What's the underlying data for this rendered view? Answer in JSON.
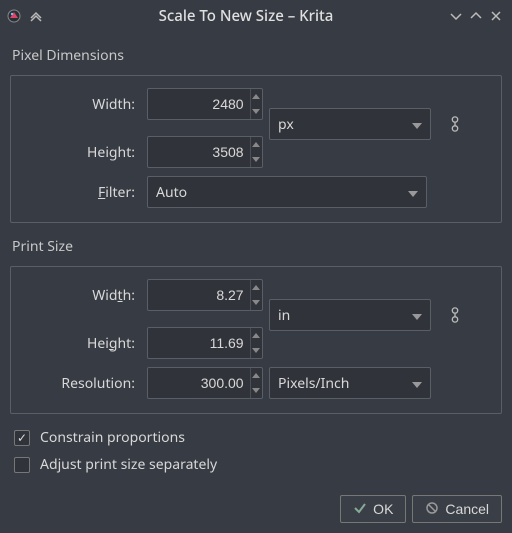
{
  "window": {
    "title": "Scale To New Size – Krita"
  },
  "pixel_dimensions": {
    "title": "Pixel Dimensions",
    "width_label_pre": "",
    "width_label": "Width:",
    "height_label": "Height:",
    "filter_label_pre": "F",
    "filter_label_post": "ilter:",
    "width_value": "2480",
    "height_value": "3508",
    "unit": "px",
    "filter_value": "Auto"
  },
  "print_size": {
    "title": "Print Size",
    "width_label_pre": "Wid",
    "width_label_ul": "t",
    "width_label_post": "h:",
    "height_label_pre": "Hei",
    "height_label_ul": "g",
    "height_label_post": "ht:",
    "resolution_label": "Resolution:",
    "width_value": "8.27",
    "height_value": "11.69",
    "resolution_value": "300.00",
    "unit": "in",
    "res_unit": "Pixels/Inch"
  },
  "options": {
    "constrain_pre": "Constrain ",
    "constrain_ul": "p",
    "constrain_post": "roportions",
    "constrain_checked": true,
    "adjust_ul": "A",
    "adjust_post": "djust print size separately",
    "adjust_checked": false
  },
  "buttons": {
    "ok_ul": "O",
    "ok_post": "K",
    "cancel_ul": "C",
    "cancel_post": "ancel"
  }
}
